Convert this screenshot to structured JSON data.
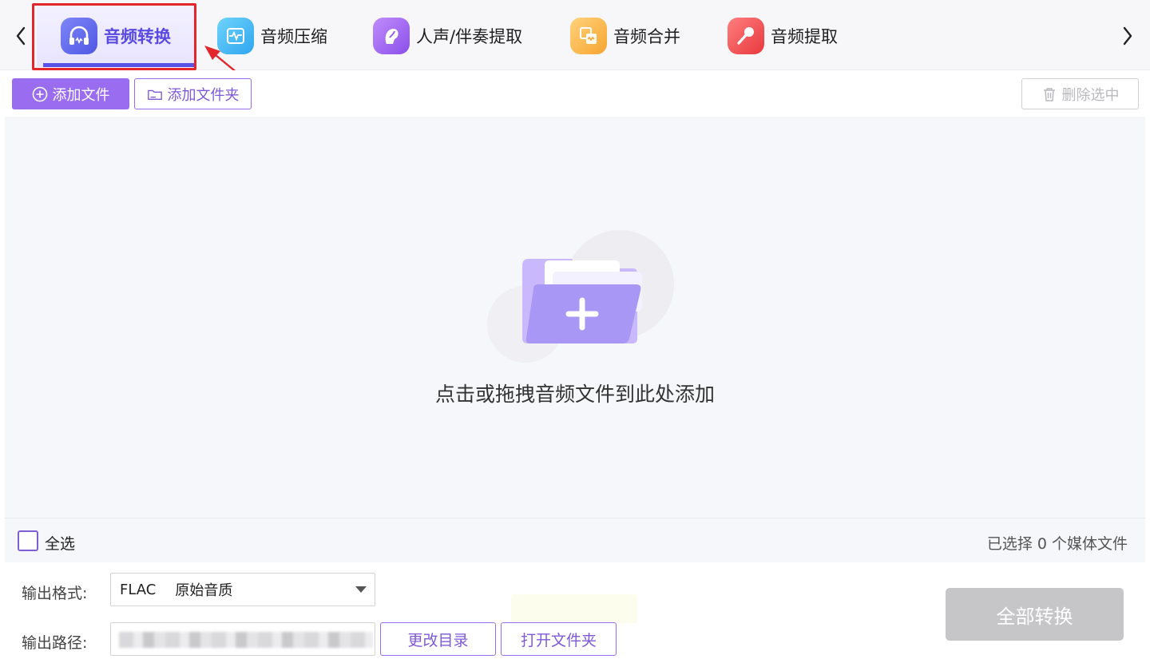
{
  "tabs": [
    {
      "label": "音频转换",
      "icon": "headphones-icon",
      "active": true,
      "color": "#5b62ea"
    },
    {
      "label": "音频压缩",
      "icon": "waveform-icon",
      "active": false,
      "color": "#36b5f3"
    },
    {
      "label": "人声/伴奏提取",
      "icon": "voice-icon",
      "active": false,
      "color": "#9b5ff0"
    },
    {
      "label": "音频合并",
      "icon": "merge-icon",
      "active": false,
      "color": "#f9b441"
    },
    {
      "label": "音频提取",
      "icon": "microphone-icon",
      "active": false,
      "color": "#ef4b4b"
    }
  ],
  "toolbar": {
    "add_file_label": "添加文件",
    "add_folder_label": "添加文件夹",
    "delete_selected_label": "删除选中"
  },
  "dropzone": {
    "hint": "点击或拖拽音频文件到此处添加"
  },
  "selection": {
    "select_all_label": "全选",
    "selected_count_text": "已选择 0 个媒体文件"
  },
  "output": {
    "format_label": "输出格式:",
    "format_value": "FLAC",
    "quality_value": "原始音质",
    "path_label": "输出路径:",
    "change_dir_label": "更改目录",
    "open_folder_label": "打开文件夹"
  },
  "actions": {
    "convert_all_label": "全部转换"
  },
  "colors": {
    "accent": "#9a6cf0",
    "active_tab_text": "#5a4ae3",
    "annotation_red": "#e3262b",
    "disabled_button": "#c6c6c8"
  }
}
